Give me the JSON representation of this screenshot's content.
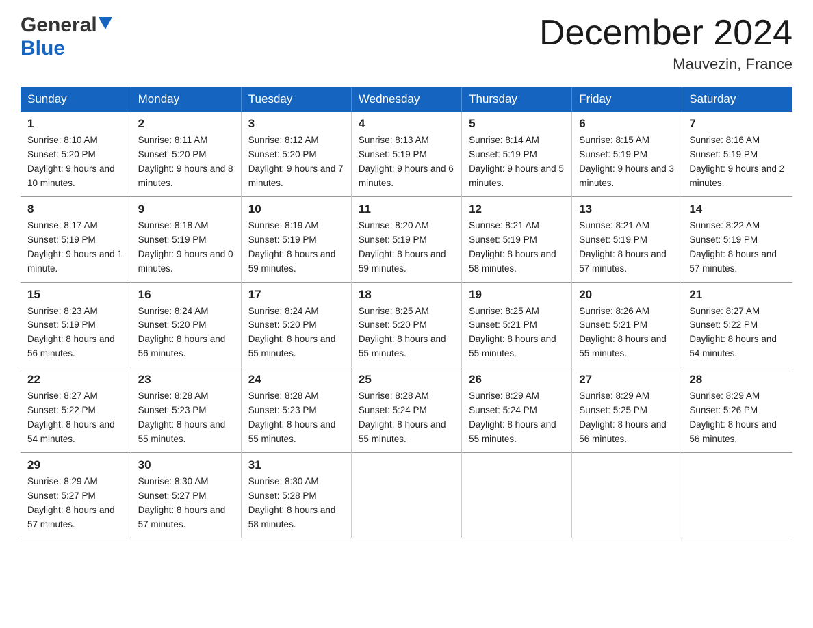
{
  "header": {
    "logo_general": "General",
    "logo_blue": "Blue",
    "title": "December 2024",
    "subtitle": "Mauvezin, France"
  },
  "days_of_week": [
    "Sunday",
    "Monday",
    "Tuesday",
    "Wednesday",
    "Thursday",
    "Friday",
    "Saturday"
  ],
  "weeks": [
    [
      {
        "day": "1",
        "sunrise": "8:10 AM",
        "sunset": "5:20 PM",
        "daylight": "9 hours and 10 minutes."
      },
      {
        "day": "2",
        "sunrise": "8:11 AM",
        "sunset": "5:20 PM",
        "daylight": "9 hours and 8 minutes."
      },
      {
        "day": "3",
        "sunrise": "8:12 AM",
        "sunset": "5:20 PM",
        "daylight": "9 hours and 7 minutes."
      },
      {
        "day": "4",
        "sunrise": "8:13 AM",
        "sunset": "5:19 PM",
        "daylight": "9 hours and 6 minutes."
      },
      {
        "day": "5",
        "sunrise": "8:14 AM",
        "sunset": "5:19 PM",
        "daylight": "9 hours and 5 minutes."
      },
      {
        "day": "6",
        "sunrise": "8:15 AM",
        "sunset": "5:19 PM",
        "daylight": "9 hours and 3 minutes."
      },
      {
        "day": "7",
        "sunrise": "8:16 AM",
        "sunset": "5:19 PM",
        "daylight": "9 hours and 2 minutes."
      }
    ],
    [
      {
        "day": "8",
        "sunrise": "8:17 AM",
        "sunset": "5:19 PM",
        "daylight": "9 hours and 1 minute."
      },
      {
        "day": "9",
        "sunrise": "8:18 AM",
        "sunset": "5:19 PM",
        "daylight": "9 hours and 0 minutes."
      },
      {
        "day": "10",
        "sunrise": "8:19 AM",
        "sunset": "5:19 PM",
        "daylight": "8 hours and 59 minutes."
      },
      {
        "day": "11",
        "sunrise": "8:20 AM",
        "sunset": "5:19 PM",
        "daylight": "8 hours and 59 minutes."
      },
      {
        "day": "12",
        "sunrise": "8:21 AM",
        "sunset": "5:19 PM",
        "daylight": "8 hours and 58 minutes."
      },
      {
        "day": "13",
        "sunrise": "8:21 AM",
        "sunset": "5:19 PM",
        "daylight": "8 hours and 57 minutes."
      },
      {
        "day": "14",
        "sunrise": "8:22 AM",
        "sunset": "5:19 PM",
        "daylight": "8 hours and 57 minutes."
      }
    ],
    [
      {
        "day": "15",
        "sunrise": "8:23 AM",
        "sunset": "5:19 PM",
        "daylight": "8 hours and 56 minutes."
      },
      {
        "day": "16",
        "sunrise": "8:24 AM",
        "sunset": "5:20 PM",
        "daylight": "8 hours and 56 minutes."
      },
      {
        "day": "17",
        "sunrise": "8:24 AM",
        "sunset": "5:20 PM",
        "daylight": "8 hours and 55 minutes."
      },
      {
        "day": "18",
        "sunrise": "8:25 AM",
        "sunset": "5:20 PM",
        "daylight": "8 hours and 55 minutes."
      },
      {
        "day": "19",
        "sunrise": "8:25 AM",
        "sunset": "5:21 PM",
        "daylight": "8 hours and 55 minutes."
      },
      {
        "day": "20",
        "sunrise": "8:26 AM",
        "sunset": "5:21 PM",
        "daylight": "8 hours and 55 minutes."
      },
      {
        "day": "21",
        "sunrise": "8:27 AM",
        "sunset": "5:22 PM",
        "daylight": "8 hours and 54 minutes."
      }
    ],
    [
      {
        "day": "22",
        "sunrise": "8:27 AM",
        "sunset": "5:22 PM",
        "daylight": "8 hours and 54 minutes."
      },
      {
        "day": "23",
        "sunrise": "8:28 AM",
        "sunset": "5:23 PM",
        "daylight": "8 hours and 55 minutes."
      },
      {
        "day": "24",
        "sunrise": "8:28 AM",
        "sunset": "5:23 PM",
        "daylight": "8 hours and 55 minutes."
      },
      {
        "day": "25",
        "sunrise": "8:28 AM",
        "sunset": "5:24 PM",
        "daylight": "8 hours and 55 minutes."
      },
      {
        "day": "26",
        "sunrise": "8:29 AM",
        "sunset": "5:24 PM",
        "daylight": "8 hours and 55 minutes."
      },
      {
        "day": "27",
        "sunrise": "8:29 AM",
        "sunset": "5:25 PM",
        "daylight": "8 hours and 56 minutes."
      },
      {
        "day": "28",
        "sunrise": "8:29 AM",
        "sunset": "5:26 PM",
        "daylight": "8 hours and 56 minutes."
      }
    ],
    [
      {
        "day": "29",
        "sunrise": "8:29 AM",
        "sunset": "5:27 PM",
        "daylight": "8 hours and 57 minutes."
      },
      {
        "day": "30",
        "sunrise": "8:30 AM",
        "sunset": "5:27 PM",
        "daylight": "8 hours and 57 minutes."
      },
      {
        "day": "31",
        "sunrise": "8:30 AM",
        "sunset": "5:28 PM",
        "daylight": "8 hours and 58 minutes."
      },
      null,
      null,
      null,
      null
    ]
  ],
  "labels": {
    "sunrise": "Sunrise:",
    "sunset": "Sunset:",
    "daylight": "Daylight:"
  }
}
